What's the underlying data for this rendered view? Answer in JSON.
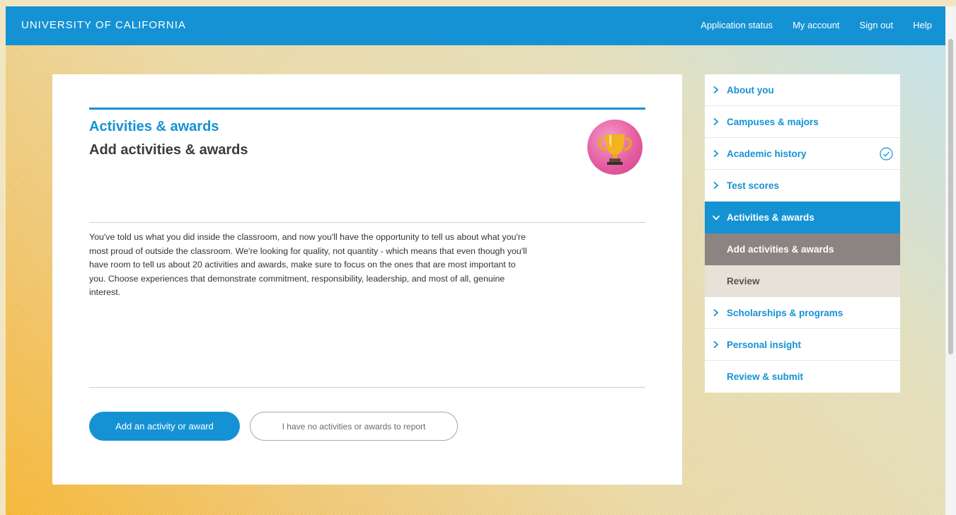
{
  "header": {
    "brand": "UNIVERSITY OF CALIFORNIA",
    "links": [
      "Application status",
      "My account",
      "Sign out",
      "Help"
    ],
    "color": "#1592d4"
  },
  "main": {
    "section_title": "Activities & awards",
    "page_title": "Add activities & awards",
    "badge_icon": "trophy-icon",
    "intro": "You've told us what you did inside the classroom, and now you'll have the opportunity to tell us about what you're most proud of outside the classroom. We're looking for quality, not quantity - which means that even though you'll have room to tell us about 20 activities and awards, make sure to focus on the ones that are most important to you. Choose experiences that demonstrate commitment, responsibility, leadership, and most of all, genuine interest.",
    "primary_button": "Add an activity or award",
    "secondary_button": "I have no activities or awards to report"
  },
  "sidebar": {
    "items": [
      {
        "label": "About you",
        "state": "collapsed"
      },
      {
        "label": "Campuses & majors",
        "state": "collapsed"
      },
      {
        "label": "Academic history",
        "state": "collapsed",
        "completed": true
      },
      {
        "label": "Test scores",
        "state": "collapsed"
      },
      {
        "label": "Activities & awards",
        "state": "expanded"
      },
      {
        "label": "Add activities & awards",
        "state": "current-subitem"
      },
      {
        "label": "Review",
        "state": "subitem"
      },
      {
        "label": "Scholarships & programs",
        "state": "collapsed"
      },
      {
        "label": "Personal insight",
        "state": "collapsed"
      },
      {
        "label": "Review & submit",
        "state": "no-chevron"
      }
    ]
  }
}
